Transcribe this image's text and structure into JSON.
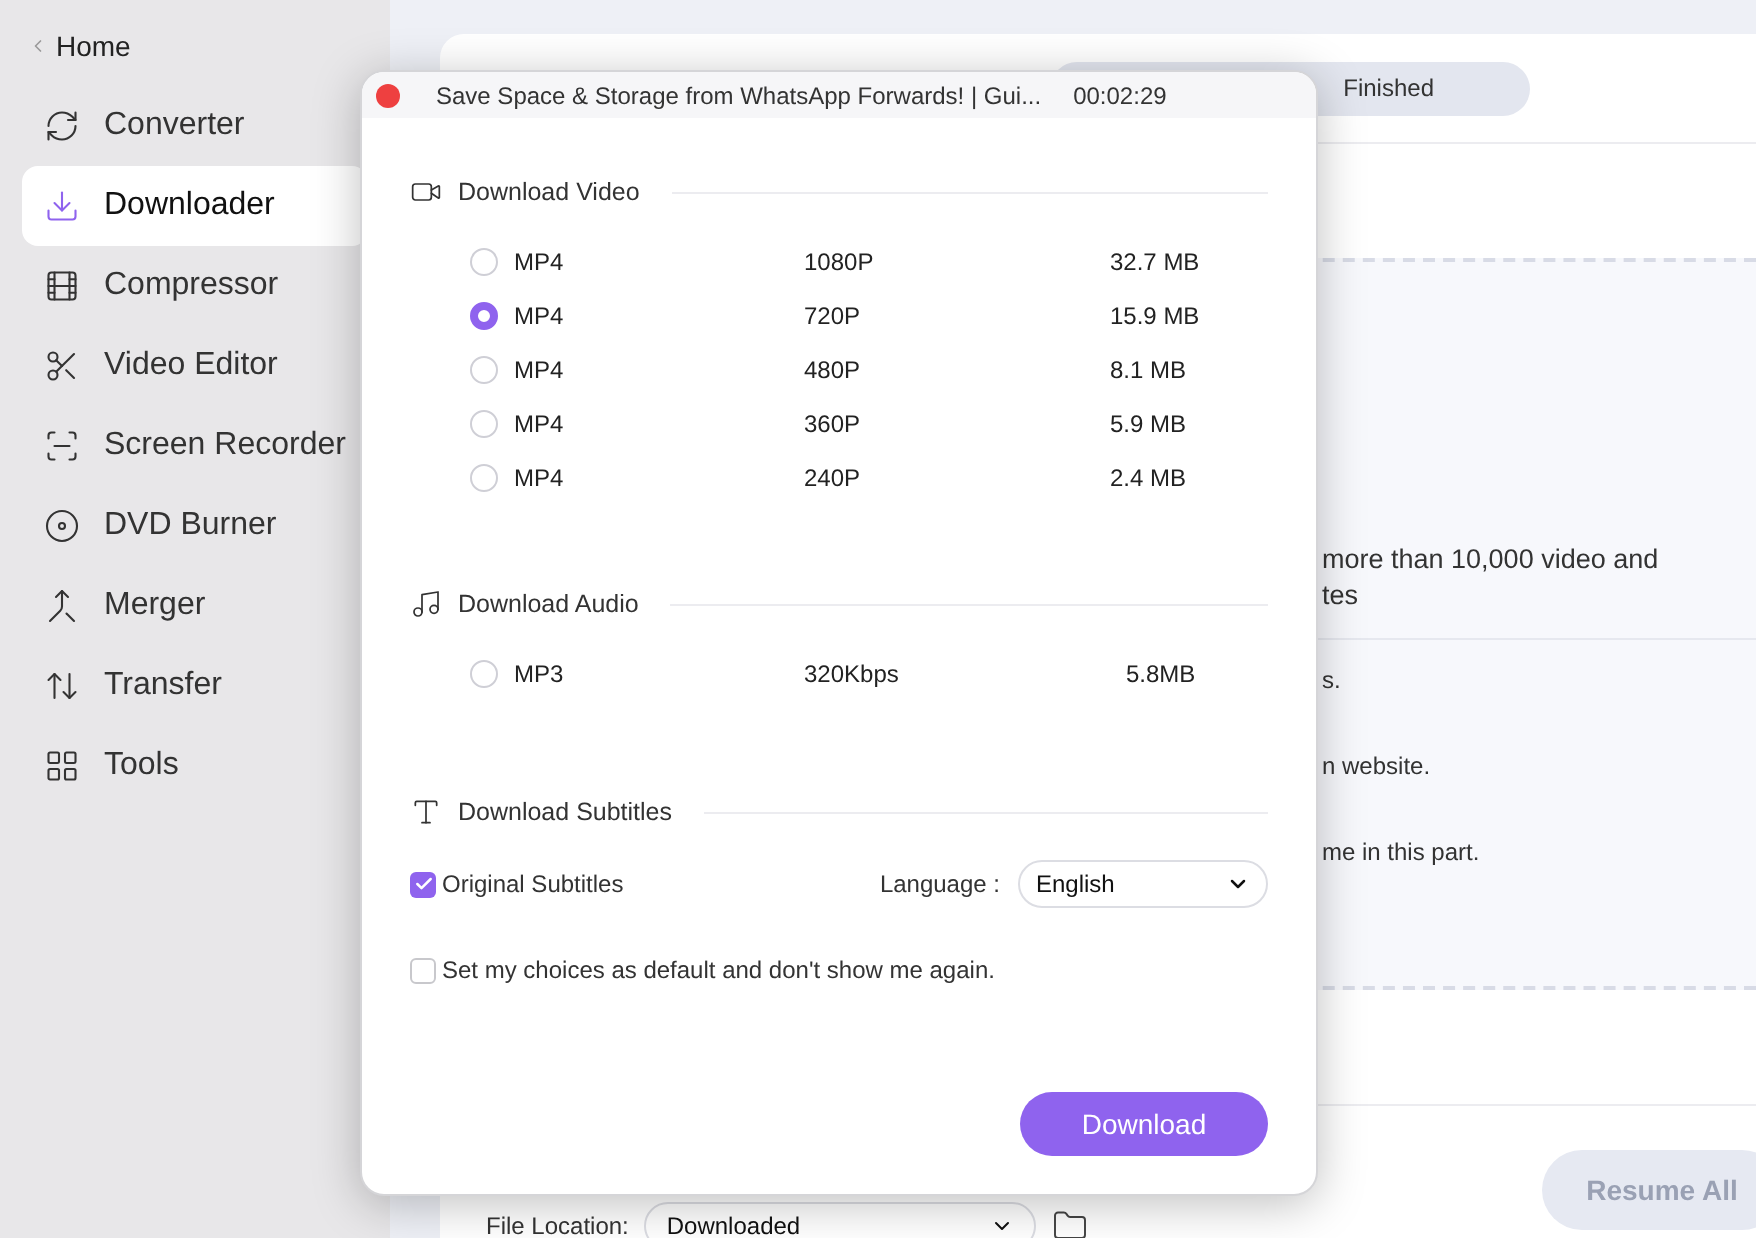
{
  "sidebar": {
    "back_label": "Home",
    "items": [
      {
        "label": "Converter",
        "selected": false
      },
      {
        "label": "Downloader",
        "selected": true
      },
      {
        "label": "Compressor",
        "selected": false
      },
      {
        "label": "Video Editor",
        "selected": false
      },
      {
        "label": "Screen Recorder",
        "selected": false
      },
      {
        "label": "DVD Burner",
        "selected": false
      },
      {
        "label": "Merger",
        "selected": false
      },
      {
        "label": "Transfer",
        "selected": false
      },
      {
        "label": "Tools",
        "selected": false
      }
    ]
  },
  "main": {
    "tabs": [
      {
        "label": "Finished",
        "selected": false
      }
    ],
    "empty_state_lines": [
      "more than 10,000 video and",
      "tes"
    ],
    "tips": [
      "s.",
      "n website.",
      "me in this part."
    ],
    "file_location": {
      "label": "File Location:",
      "value": "Downloaded"
    },
    "resume_button": {
      "label": "Resume All",
      "disabled": true
    }
  },
  "dialog": {
    "title": "Save Space & Storage from WhatsApp Forwards! | Gui...",
    "duration": "00:02:29",
    "sections": [
      {
        "kind": "video",
        "heading": "Download Video",
        "options": [
          {
            "format": "MP4",
            "quality": "1080P",
            "size": "32.7 MB",
            "selected": false
          },
          {
            "format": "MP4",
            "quality": "720P",
            "size": "15.9 MB",
            "selected": true
          },
          {
            "format": "MP4",
            "quality": "480P",
            "size": "8.1 MB",
            "selected": false
          },
          {
            "format": "MP4",
            "quality": "360P",
            "size": "5.9 MB",
            "selected": false
          },
          {
            "format": "MP4",
            "quality": "240P",
            "size": "2.4 MB",
            "selected": false
          }
        ]
      },
      {
        "kind": "audio",
        "heading": "Download Audio",
        "options": [
          {
            "format": "MP3",
            "quality": "320Kbps",
            "size": "5.8MB",
            "selected": false
          }
        ]
      }
    ],
    "subtitles": {
      "heading": "Download Subtitles",
      "original": {
        "label": "Original Subtitles",
        "checked": true
      },
      "language": {
        "label": "Language :",
        "value": "English"
      }
    },
    "default_checkbox": {
      "label": "Set my choices as default and don't show me again.",
      "checked": false
    },
    "download_button": {
      "label": "Download"
    }
  }
}
